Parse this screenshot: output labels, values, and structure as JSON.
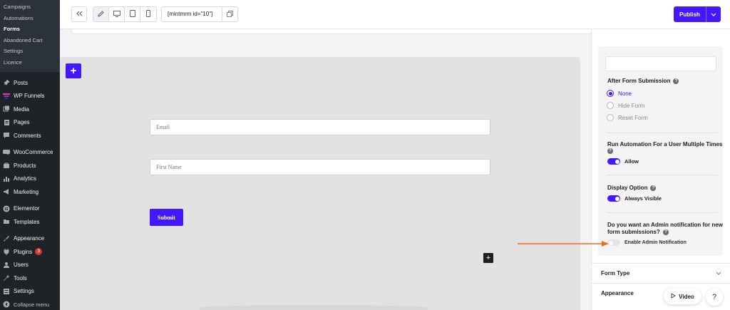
{
  "sidebar": {
    "submenu": [
      {
        "label": "Campaigns"
      },
      {
        "label": "Automations"
      },
      {
        "label": "Forms"
      },
      {
        "label": "Abandoned Cart"
      },
      {
        "label": "Settings"
      },
      {
        "label": "Licence"
      }
    ],
    "menu": [
      {
        "label": "Posts",
        "icon": "pin-icon"
      },
      {
        "label": "WP Funnels",
        "icon": "funnel-icon"
      },
      {
        "label": "Media",
        "icon": "media-icon"
      },
      {
        "label": "Pages",
        "icon": "pages-icon"
      },
      {
        "label": "Comments",
        "icon": "comment-icon"
      },
      {
        "label": "WooCommerce",
        "icon": "woocommerce-icon"
      },
      {
        "label": "Products",
        "icon": "products-icon"
      },
      {
        "label": "Analytics",
        "icon": "analytics-icon"
      },
      {
        "label": "Marketing",
        "icon": "megaphone-icon"
      },
      {
        "label": "Elementor",
        "icon": "elementor-icon"
      },
      {
        "label": "Templates",
        "icon": "templates-icon"
      },
      {
        "label": "Appearance",
        "icon": "brush-icon"
      },
      {
        "label": "Plugins",
        "icon": "plugin-icon",
        "badge": "3"
      },
      {
        "label": "Users",
        "icon": "users-icon"
      },
      {
        "label": "Tools",
        "icon": "wrench-icon"
      },
      {
        "label": "Settings",
        "icon": "settings-icon"
      },
      {
        "label": "Collapse menu",
        "icon": "collapse-icon"
      }
    ]
  },
  "topbar": {
    "shortcode": "[mintmrm id=\"10\"]",
    "publish_label": "Publish"
  },
  "form": {
    "email_placeholder": "Email",
    "first_name_placeholder": "First Name",
    "submit_label": "Submit"
  },
  "panel": {
    "after_submission_label": "After Form Submission",
    "after_submission_options": [
      "None",
      "Hide Form",
      "Reset Form"
    ],
    "after_submission_selected": "None",
    "run_automation_label": "Run Automation For a User Multiple Times",
    "allow_label": "Allow",
    "allow_on": true,
    "display_option_label": "Display Option",
    "always_visible_label": "Always Visible",
    "always_visible_on": true,
    "admin_notification_label_1": "Do you want an Admin notification for new",
    "admin_notification_label_2": "form submissions?",
    "enable_admin_label": "Enable Admin Notification",
    "enable_admin_on": false,
    "form_type_label": "Form Type",
    "appearance_label": "Appearance"
  },
  "floating": {
    "video_label": "Video",
    "help_label": "?"
  },
  "colors": {
    "accent": "#4318ff",
    "arrow": "#f36b21",
    "sidebar_bg": "#1d2327"
  }
}
